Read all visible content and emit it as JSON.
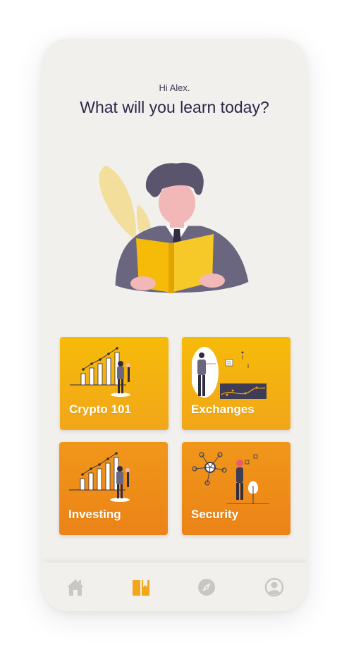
{
  "header": {
    "greeting": "Hi Alex.",
    "headline": "What will you learn today?"
  },
  "cards": [
    {
      "label": "Crypto 101"
    },
    {
      "label": "Exchanges"
    },
    {
      "label": "Investing"
    },
    {
      "label": "Security"
    }
  ],
  "tabbar": {
    "tabs": [
      {
        "icon": "home-icon",
        "active": false
      },
      {
        "icon": "book-icon",
        "active": true
      },
      {
        "icon": "compass-icon",
        "active": false
      },
      {
        "icon": "profile-icon",
        "active": false
      }
    ],
    "active_color": "#f2a619",
    "inactive_color": "#c9c7c3"
  },
  "colors": {
    "background": "#f1f0ed",
    "headline": "#2b2748",
    "card_yellow": "#f6bb09",
    "card_orange": "#ec8317"
  }
}
